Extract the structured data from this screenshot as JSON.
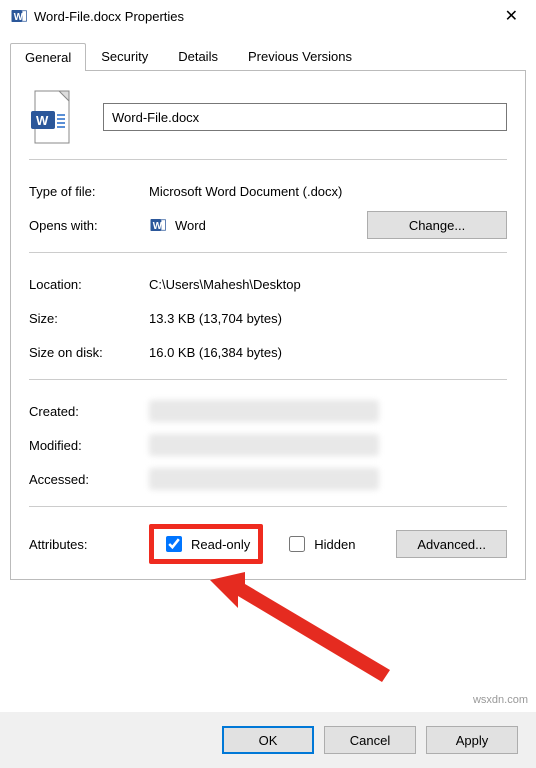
{
  "window": {
    "title": "Word-File.docx Properties",
    "close_icon": "✕"
  },
  "tabs": {
    "general": "General",
    "security": "Security",
    "details": "Details",
    "previous_versions": "Previous Versions"
  },
  "file": {
    "name": "Word-File.docx"
  },
  "labels": {
    "type_of_file": "Type of file:",
    "opens_with": "Opens with:",
    "location": "Location:",
    "size": "Size:",
    "size_on_disk": "Size on disk:",
    "created": "Created:",
    "modified": "Modified:",
    "accessed": "Accessed:",
    "attributes": "Attributes:"
  },
  "values": {
    "type_of_file": "Microsoft Word Document (.docx)",
    "opens_with": "Word",
    "location": "C:\\Users\\Mahesh\\Desktop",
    "size": "13.3 KB (13,704 bytes)",
    "size_on_disk": "16.0 KB (16,384 bytes)"
  },
  "buttons": {
    "change": "Change...",
    "advanced": "Advanced...",
    "ok": "OK",
    "cancel": "Cancel",
    "apply": "Apply"
  },
  "attributes": {
    "read_only_label": "Read-only",
    "read_only_checked": true,
    "hidden_label": "Hidden",
    "hidden_checked": false
  },
  "watermark": "wsxdn.com"
}
